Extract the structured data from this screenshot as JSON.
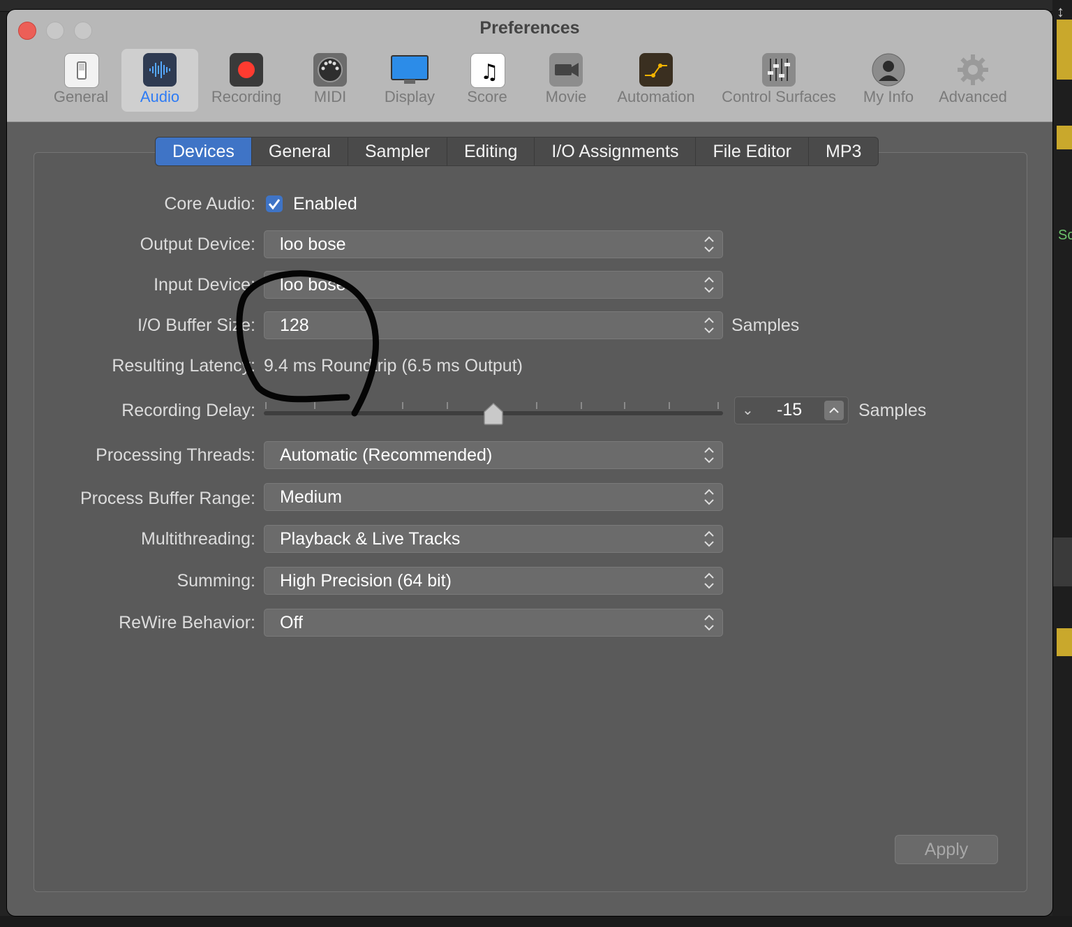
{
  "window": {
    "title": "Preferences"
  },
  "toolbar": {
    "items": [
      {
        "label": "General",
        "icon": "switch-icon"
      },
      {
        "label": "Audio",
        "icon": "waveform-icon",
        "active": true
      },
      {
        "label": "Recording",
        "icon": "record-icon"
      },
      {
        "label": "MIDI",
        "icon": "midi-port-icon"
      },
      {
        "label": "Display",
        "icon": "monitor-icon"
      },
      {
        "label": "Score",
        "icon": "music-note-icon"
      },
      {
        "label": "Movie",
        "icon": "video-camera-icon"
      },
      {
        "label": "Automation",
        "icon": "automation-curve-icon"
      },
      {
        "label": "Control Surfaces",
        "icon": "fader-icon"
      },
      {
        "label": "My Info",
        "icon": "user-icon"
      },
      {
        "label": "Advanced",
        "icon": "gear-icon"
      }
    ]
  },
  "tabs": [
    "Devices",
    "General",
    "Sampler",
    "Editing",
    "I/O Assignments",
    "File Editor",
    "MP3"
  ],
  "form": {
    "core_audio_label": "Core Audio:",
    "core_audio_value": "Enabled",
    "output_device_label": "Output Device:",
    "output_device_value": "loo bose",
    "input_device_label": "Input Device:",
    "input_device_value": "loo bose",
    "buffer_label": "I/O Buffer Size:",
    "buffer_value": "128",
    "buffer_unit": "Samples",
    "latency_label": "Resulting Latency:",
    "latency_value": "9.4 ms Roundtrip (6.5 ms Output)",
    "rec_delay_label": "Recording Delay:",
    "rec_delay_value": "-15",
    "rec_delay_unit": "Samples",
    "threads_label": "Processing Threads:",
    "threads_value": "Automatic (Recommended)",
    "range_label": "Process Buffer Range:",
    "range_value": "Medium",
    "multi_label": "Multithreading:",
    "multi_value": "Playback & Live Tracks",
    "summing_label": "Summing:",
    "summing_value": "High Precision (64 bit)",
    "rewire_label": "ReWire Behavior:",
    "rewire_value": "Off"
  },
  "apply_label": "Apply",
  "colors": {
    "accent": "#3f74c6",
    "active_toolbar_text": "#2d7bf5",
    "close_button": "#ec5f57"
  },
  "background_app": {
    "side_text": "Sc"
  }
}
